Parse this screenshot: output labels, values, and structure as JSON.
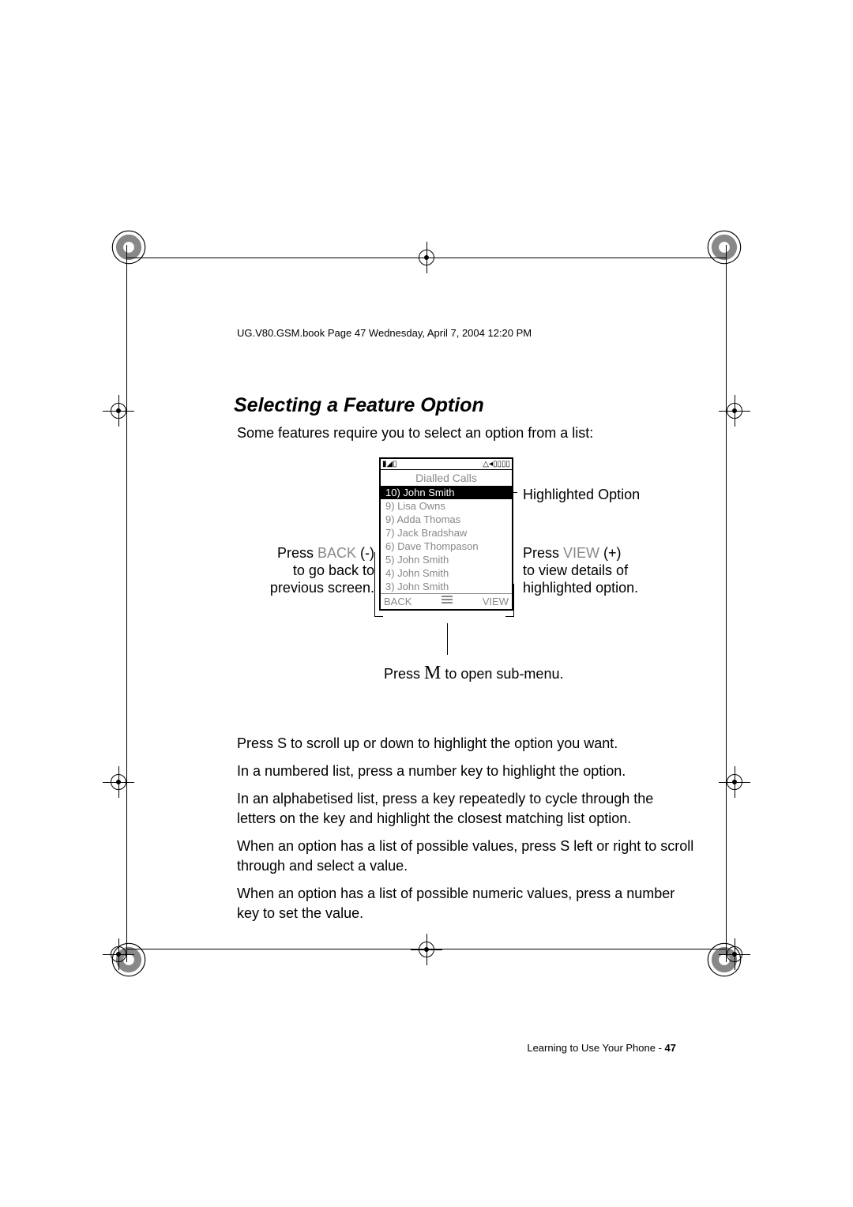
{
  "header_path": "UG.V80.GSM.book  Page 47  Wednesday, April 7, 2004  12:20 PM",
  "section_title": "Selecting a Feature Option",
  "intro": "Some features require you to select an option from a list:",
  "phone": {
    "status_left": "▮◢▯",
    "status_right": "△◂▯▯▯▯",
    "screen_title": "Dialled Calls",
    "items": [
      "10) John Smith",
      "9) Lisa Owns",
      "9) Adda Thomas",
      "7) Jack Bradshaw",
      "6) Dave Thompason",
      "5) John Smith",
      "4) John Smith",
      "3) John Smith"
    ],
    "soft_left": "BACK",
    "soft_right": "VIEW"
  },
  "labels": {
    "left": {
      "press": "Press ",
      "key": "BACK",
      "paren": " (-)",
      "rest": "to go back to previous screen."
    },
    "right_top": "Highlighted Option",
    "right_bot": {
      "press": "Press ",
      "key": "VIEW",
      "paren": " (+)",
      "rest": "to view details of highlighted option."
    },
    "bottom": {
      "press": "Press ",
      "key": "M",
      "rest": "  to open sub-menu."
    }
  },
  "body": [
    "Press S   to scroll up or down to highlight the option you want.",
    "In a numbered list, press a number key to highlight the option.",
    "In an alphabetised list, press a key repeatedly to cycle through the letters on the key and highlight the closest matching list option.",
    "When an option has a list of possible values, press S   left or right to scroll through and select a value.",
    "When an option has a list of possible numeric values, press a number key to set the value."
  ],
  "footer": {
    "text": "Learning to Use Your Phone - ",
    "page": "47"
  }
}
